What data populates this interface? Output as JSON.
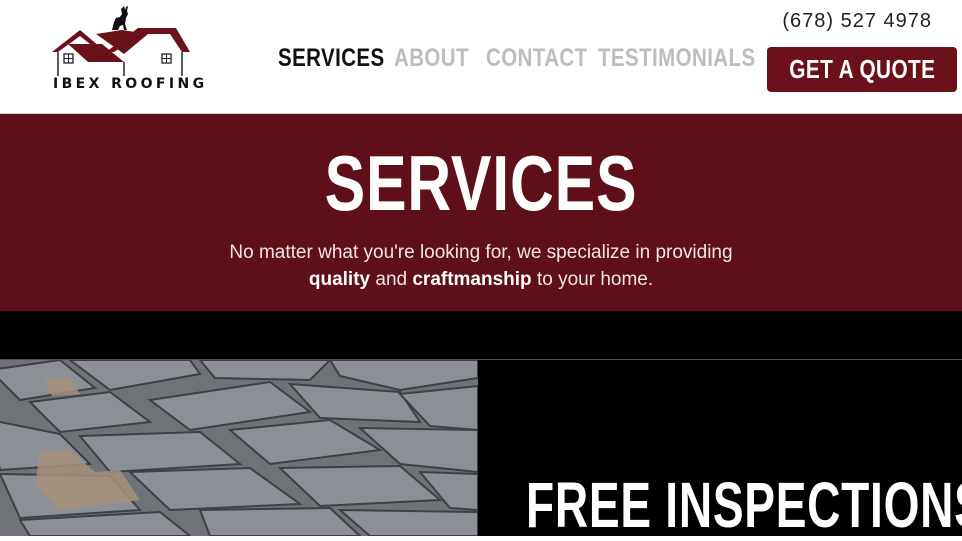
{
  "brand": {
    "name": "IBEX ROOFING",
    "brand_color": "#5e0f19"
  },
  "header": {
    "phone": "(678) 527 4978",
    "nav": [
      {
        "label": "SERVICES",
        "active": true
      },
      {
        "label": "ABOUT",
        "active": false
      },
      {
        "label": "CONTACT",
        "active": false
      },
      {
        "label": "TESTIMONIALS",
        "active": false
      }
    ],
    "cta_label": "GET A QUOTE"
  },
  "banner": {
    "title": "SERVICES",
    "line1": "No matter what you're looking for, we specialize in providing",
    "line2_bold1": "quality",
    "line2_mid": " and ",
    "line2_bold2": "craftmanship",
    "line2_end": " to your home."
  },
  "inspection": {
    "title": "FREE INSPECTIONS"
  },
  "icons": {
    "logo": "goat-on-house-roof-icon"
  }
}
